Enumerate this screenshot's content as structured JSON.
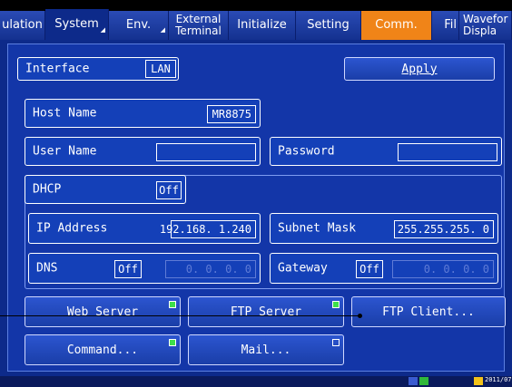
{
  "tabs": [
    {
      "label": "ulation"
    },
    {
      "label": "System"
    },
    {
      "label": "Env."
    },
    {
      "label_line1": "External",
      "label_line2": "Terminal"
    },
    {
      "label": "Initialize"
    },
    {
      "label": "Setting"
    },
    {
      "label": "Comm."
    },
    {
      "label": "Fil"
    },
    {
      "label_line1": "Wavefor",
      "label_line2": "Displa"
    }
  ],
  "interface": {
    "label": "Interface",
    "value": "LAN"
  },
  "apply_label": "Apply",
  "host": {
    "label": "Host Name",
    "value": "MR8875"
  },
  "user": {
    "label": "User Name",
    "value": ""
  },
  "password": {
    "label": "Password",
    "value": ""
  },
  "dhcp": {
    "label": "DHCP",
    "value": "Off"
  },
  "ip": {
    "label": "IP Address",
    "value": "192.168.  1.240"
  },
  "subnet": {
    "label": "Subnet Mask",
    "value": "255.255.255.  0"
  },
  "dns": {
    "label": "DNS",
    "toggle": "Off",
    "value": "0.  0.  0.  0"
  },
  "gateway": {
    "label": "Gateway",
    "toggle": "Off",
    "value": "0.  0.  0.  0"
  },
  "buttons": {
    "web_server": "Web Server",
    "ftp_server": "FTP Server",
    "ftp_client": "FTP Client...",
    "command": "Command...",
    "mail": "Mail..."
  },
  "status_bar": {
    "time": "2011/07/"
  },
  "colors": {
    "accent_tab": "#f08418",
    "panel": "#1336a8",
    "led_on": "#3ee04a"
  }
}
